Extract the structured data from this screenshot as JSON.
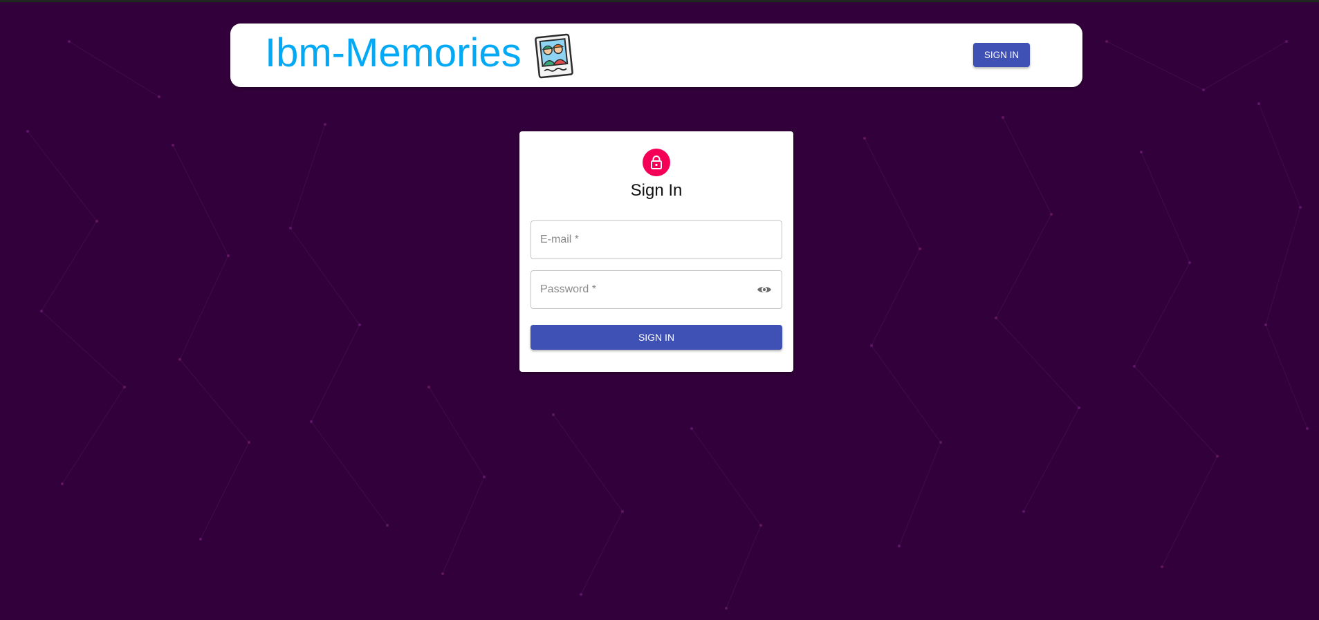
{
  "app": {
    "title": "Ibm-Memories",
    "logo_icon": "photo-memories-icon"
  },
  "nav": {
    "signin_label": "SIGN IN"
  },
  "form": {
    "lock_icon": "lock-icon",
    "title": "Sign In",
    "email": {
      "placeholder": "E-mail *",
      "value": ""
    },
    "password": {
      "placeholder": "Password *",
      "value": "",
      "toggle_icon": "eye-icon"
    },
    "submit_label": "SIGN IN"
  },
  "colors": {
    "background": "#32003a",
    "brand": "#03a9f4",
    "primary": "#3f51b5",
    "lock_avatar": "#f50057"
  }
}
